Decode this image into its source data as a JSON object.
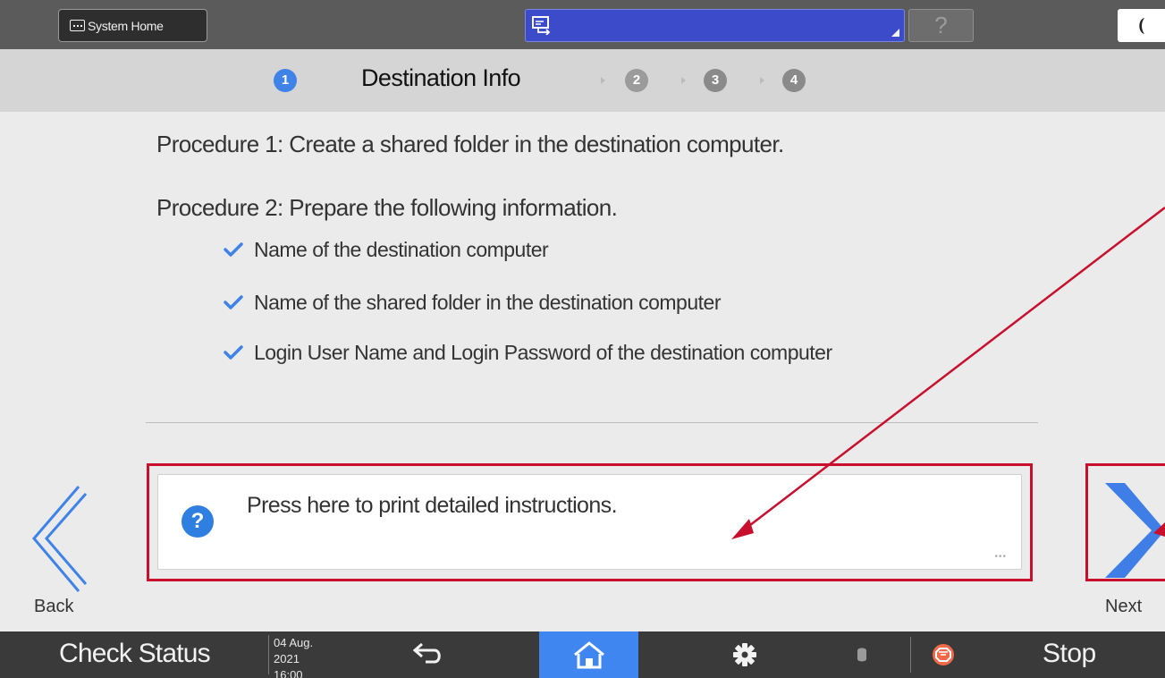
{
  "topbar": {
    "system_home_label": "System Home",
    "help_label": "?"
  },
  "steps": {
    "title": "Destination Info",
    "items": [
      {
        "number": "1",
        "state": "active"
      },
      {
        "number": "2",
        "state": "inactive"
      },
      {
        "number": "3",
        "state": "inactive"
      },
      {
        "number": "4",
        "state": "inactive"
      }
    ]
  },
  "content": {
    "procedure1": "Procedure 1: Create a shared folder in the destination computer.",
    "procedure2": "Procedure 2: Prepare the following information.",
    "checklist": [
      "Name of the destination computer",
      "Name of the shared folder in the destination computer",
      "Login User Name and Login Password of the destination computer"
    ],
    "print_instructions": "Press here to print detailed instructions."
  },
  "navigation": {
    "back_label": "Back",
    "next_label": "Next"
  },
  "bottombar": {
    "check_status_label": "Check Status",
    "date": "04 Aug. 2021",
    "time": "16:00",
    "stop_label": "Stop"
  },
  "colors": {
    "accent": "#3f83e8",
    "highlight": "#c8102e",
    "app_bar": "#3c4bc9",
    "stop": "#f06a4a"
  }
}
